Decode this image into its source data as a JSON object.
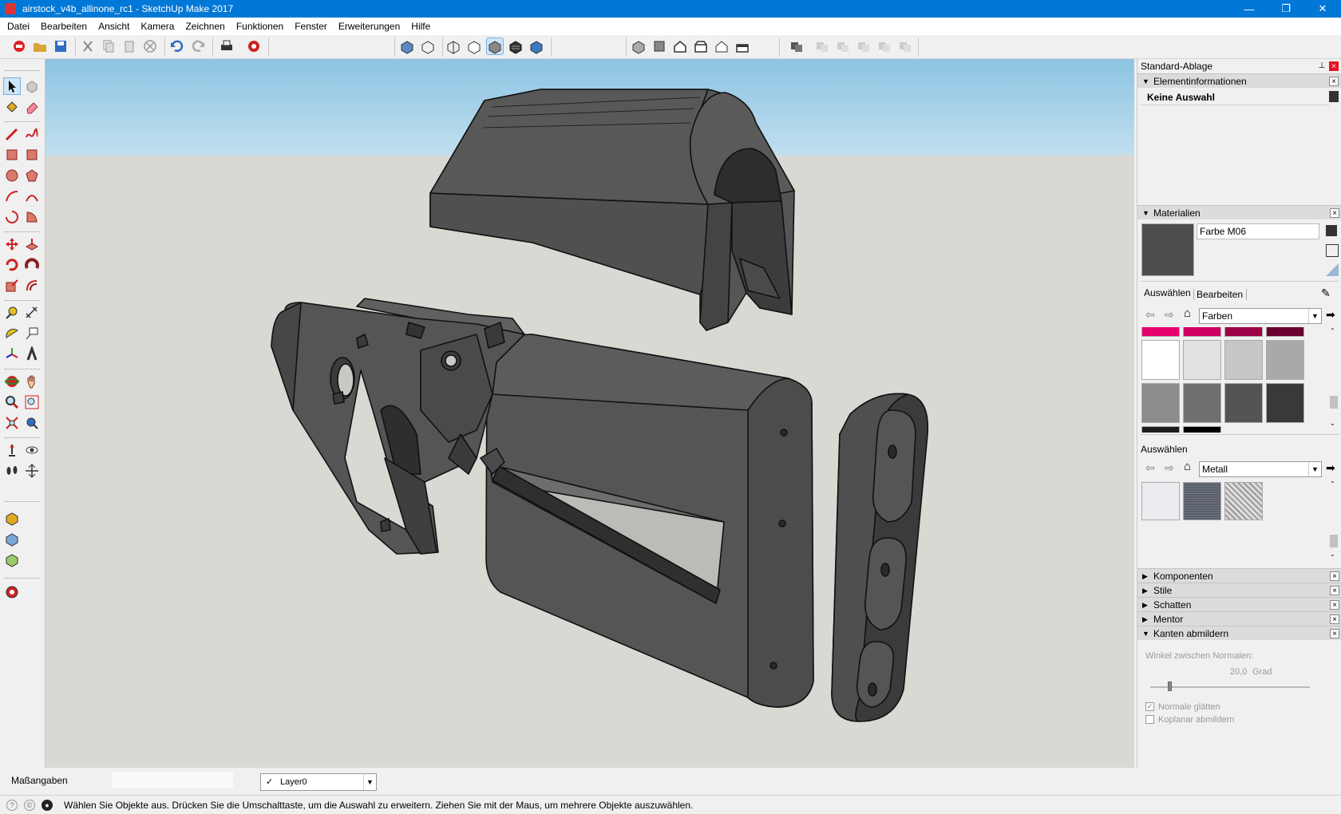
{
  "window": {
    "title": "airstock_v4b_allinone_rc1 - SketchUp Make 2017",
    "minimize": "—",
    "restore": "❐",
    "close": "✕"
  },
  "menu": [
    "Datei",
    "Bearbeiten",
    "Ansicht",
    "Kamera",
    "Zeichnen",
    "Funktionen",
    "Fenster",
    "Erweiterungen",
    "Hilfe"
  ],
  "tray": {
    "title": "Standard-Ablage",
    "element_info": {
      "header": "Elementinformationen",
      "selection": "Keine Auswahl"
    },
    "materials": {
      "header": "Materialien",
      "material_name": "Farbe M06",
      "tab_select": "Auswählen",
      "tab_edit": "Bearbeiten",
      "library1": "Farben",
      "second_label": "Auswählen",
      "library2": "Metall",
      "current_color": "#4d4d4d",
      "color_swatches": {
        "top_row": [
          "#e8006e",
          "#d00063",
          "#9c0045",
          "#6a0030"
        ],
        "row1": [
          "#ffffff",
          "#e2e2e2",
          "#c6c6c6",
          "#a9a9a9"
        ],
        "row2": [
          "#8c8c8c",
          "#6f6f6f",
          "#545454",
          "#393939"
        ],
        "bottom_row": [
          "#1c1c1c",
          "#000000"
        ]
      },
      "metal_swatches": [
        "#ecedf0",
        "#5a5f6a",
        "#bdbdbd"
      ]
    },
    "collapsed_panels": [
      "Komponenten",
      "Stile",
      "Schatten",
      "Mentor"
    ],
    "soften": {
      "header": "Kanten abmildern",
      "angle_label": "Winkel zwischen Normalen:",
      "angle_value": "20,0",
      "angle_unit": "Grad",
      "slider_fraction": 0.11,
      "smooth_label": "Normale glätten",
      "smooth_checked": true,
      "coplanar_label": "Koplanar abmildern",
      "coplanar_checked": false
    }
  },
  "bottom": {
    "measurements_label": "Maßangaben",
    "layer": "Layer0",
    "layer_check": "✓",
    "status": "Wählen Sie Objekte aus. Drücken Sie die Umschalttaste, um die Auswahl zu erweitern. Ziehen Sie mit der Maus, um mehrere Objekte auszuwählen."
  },
  "colors": {
    "accent": "#0078d7",
    "model_fill": "#555555",
    "model_dark": "#3b3b3b",
    "model_edge": "#111111"
  }
}
